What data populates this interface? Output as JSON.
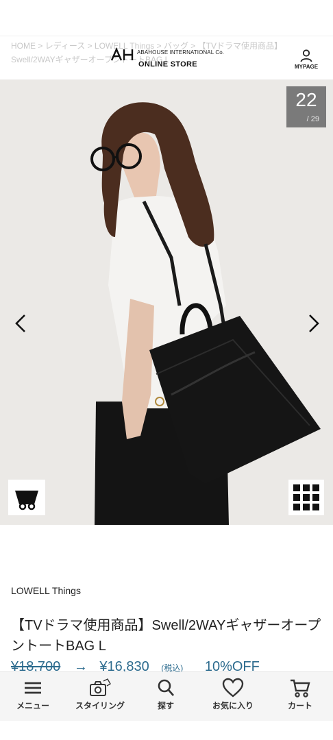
{
  "header": {
    "breadcrumb": "HOME > レディース > LOWELL Things > バッグ > 【TVドラマ使用商品】Swell/2WAYギャザーオープントートBAG L",
    "logo_company": "ABAHOUSE INTERNATIONAL Co.",
    "logo_store": "ONLINE STORE",
    "mypage_label": "MYPAGE"
  },
  "gallery": {
    "current": "22",
    "total": "/ 29",
    "photo_description": "model-with-black-tote-bag"
  },
  "product": {
    "brand": "LOWELL Things",
    "title": "【TVドラマ使用商品】Swell/2WAYギャザーオープントートBAG L",
    "old_price": "¥18,700",
    "arrow": "→",
    "new_price": "¥16,830",
    "tax_label": "(税込)",
    "discount": "10%OFF"
  },
  "bottom_nav": {
    "items": [
      {
        "label": "メニュー",
        "icon": "hamburger-icon"
      },
      {
        "label": "スタイリング",
        "icon": "camera-icon"
      },
      {
        "label": "探す",
        "icon": "search-icon"
      },
      {
        "label": "お気に入り",
        "icon": "heart-icon"
      },
      {
        "label": "カート",
        "icon": "cart-icon"
      }
    ]
  },
  "colors": {
    "price_blue": "#2c6b8e",
    "counter_bg": "#7a7a7a",
    "nav_bg": "#f5f5f5"
  }
}
